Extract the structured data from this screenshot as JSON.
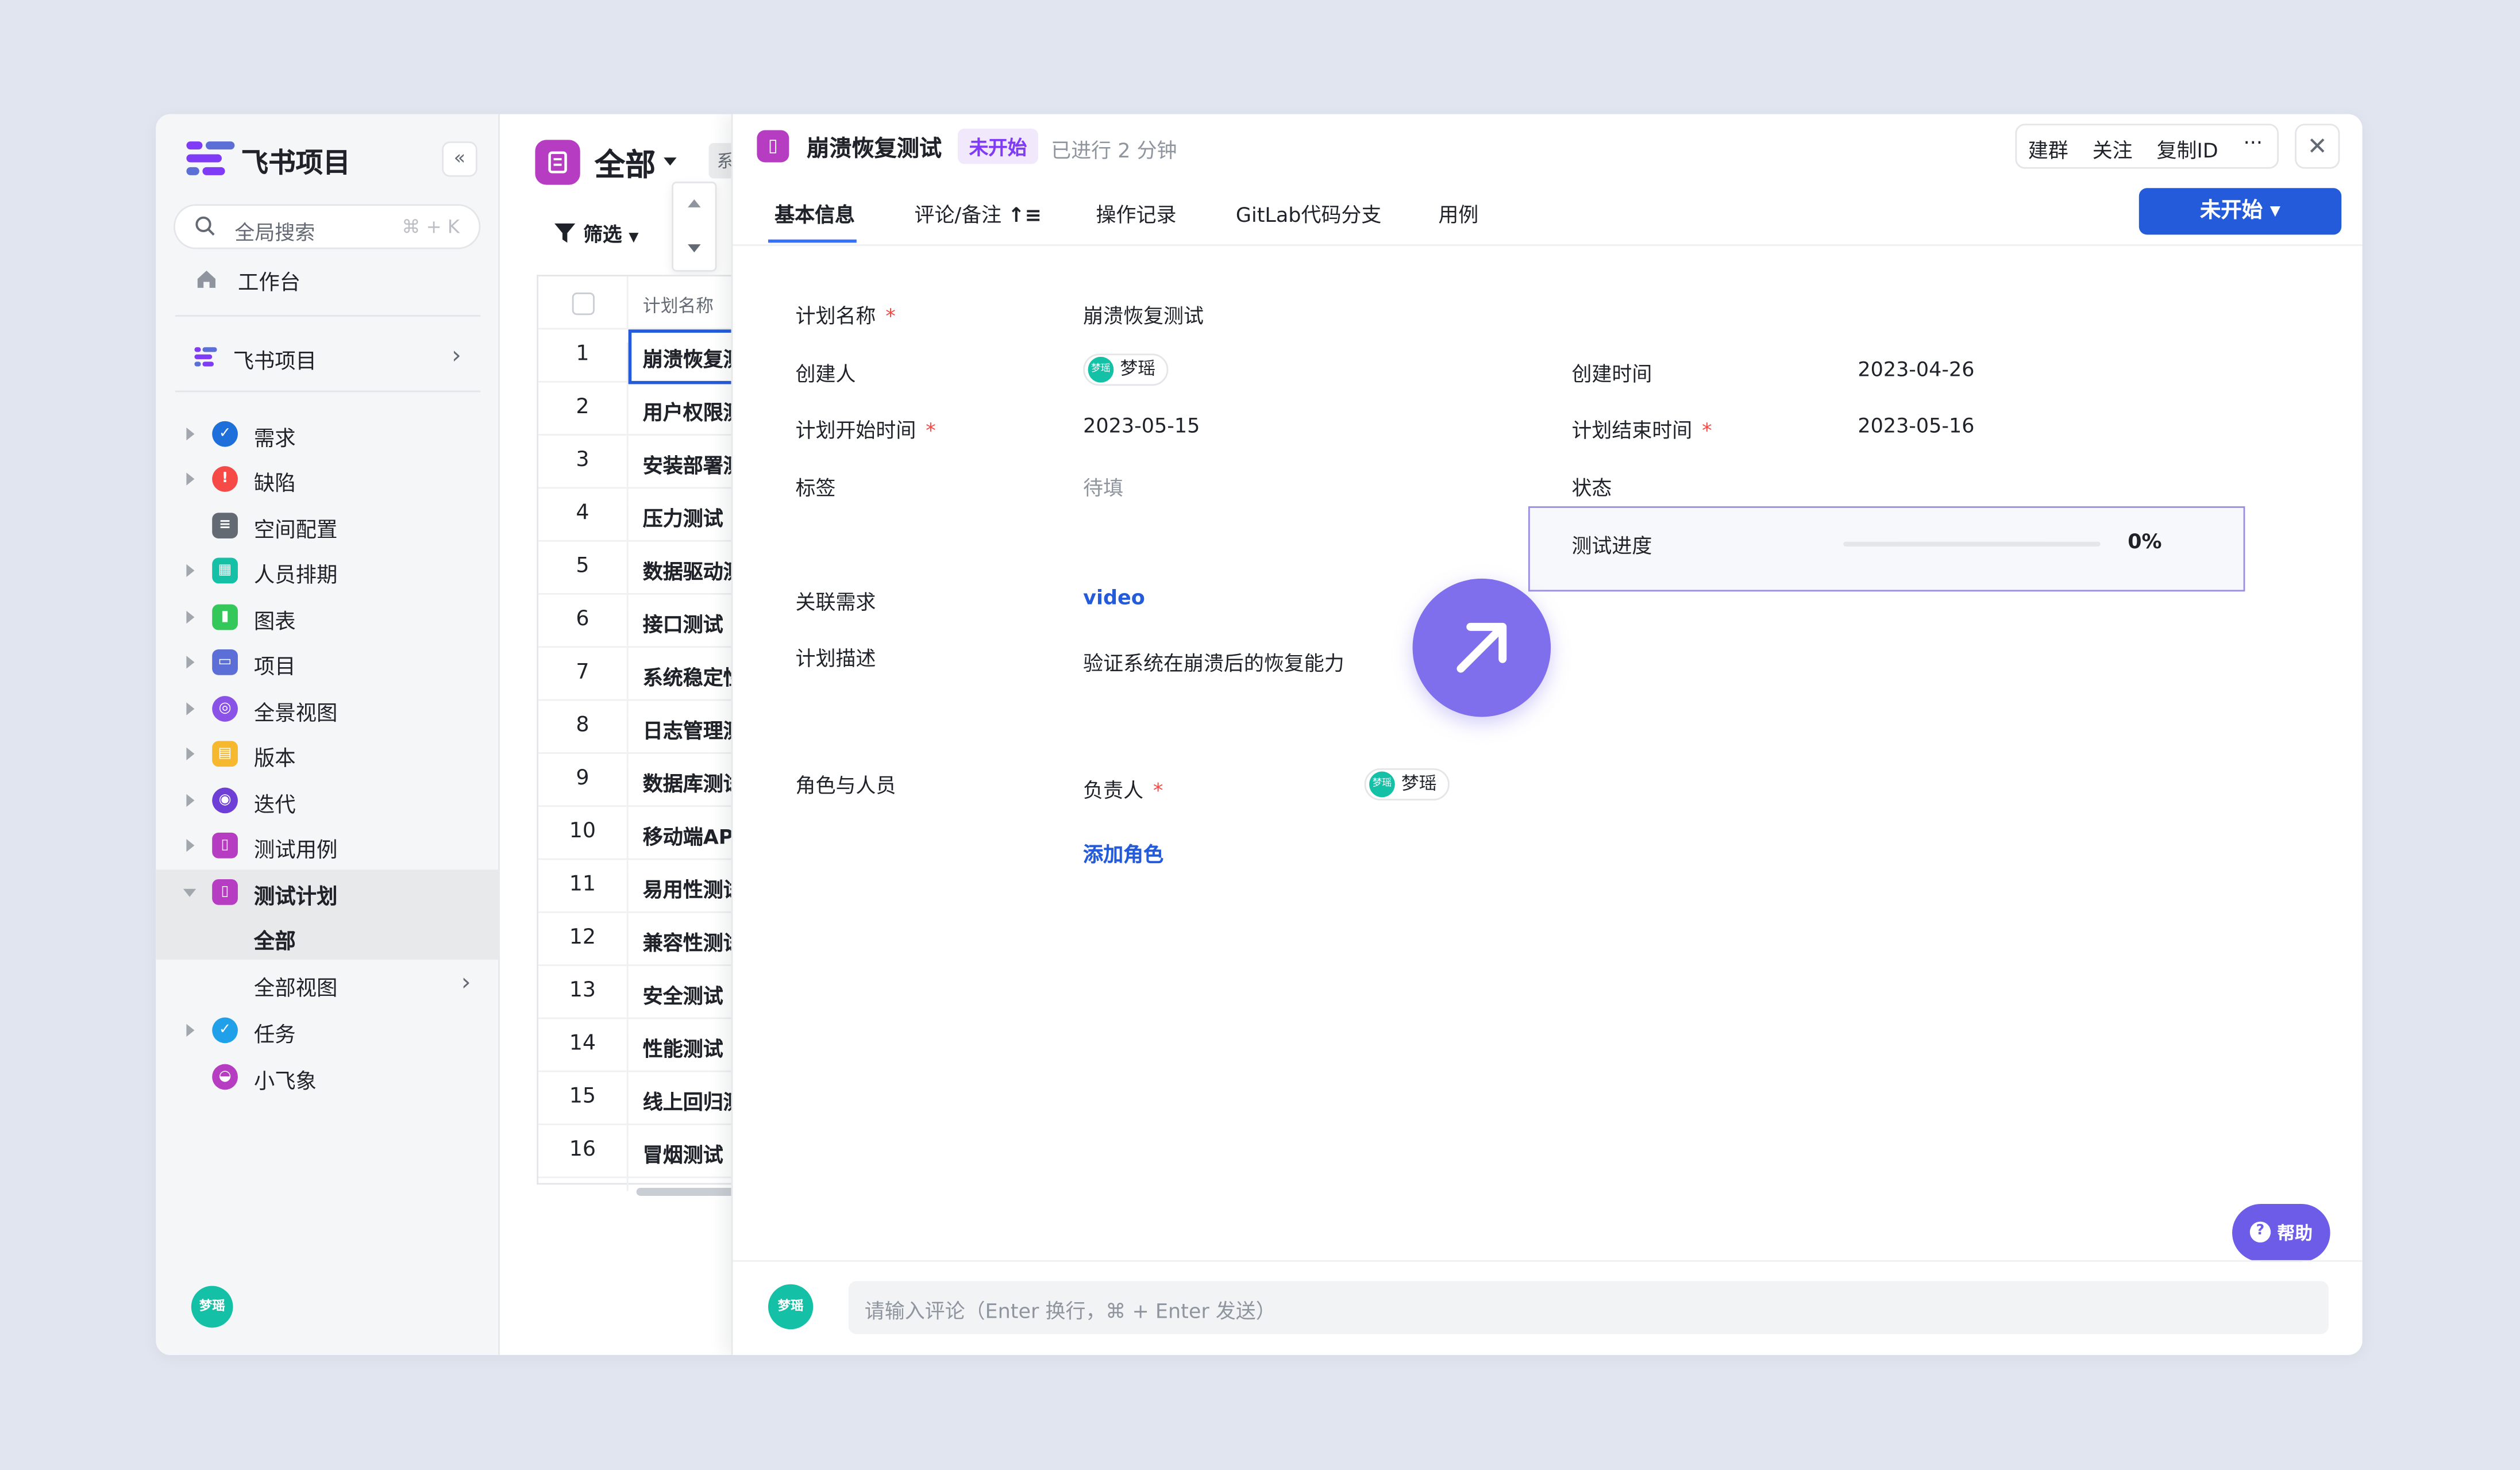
{
  "colors": {
    "brand_purple": "#b63cc2",
    "primary_blue": "#245bdb",
    "accent_purple": "#7f6fec",
    "badge_bg": "#f1e8fb",
    "badge_text": "#7f3bf5",
    "required_red": "#f54a45",
    "avatar_green": "#14c0a6"
  },
  "sidebar": {
    "brand": "飞书项目",
    "search": {
      "placeholder": "全局搜索",
      "shortcut": "⌘ + K"
    },
    "workbench": "工作台",
    "space": "飞书项目",
    "items": [
      {
        "label": "需求",
        "icon": "check-circle-icon",
        "color": "#1f6fdb"
      },
      {
        "label": "缺陷",
        "icon": "bug-icon",
        "color": "#f54a45"
      },
      {
        "label": "空间配置",
        "icon": "settings-list-icon",
        "color": "#646a73"
      },
      {
        "label": "人员排期",
        "icon": "calendar-icon",
        "color": "#14c0a6"
      },
      {
        "label": "图表",
        "icon": "chart-icon",
        "color": "#34c759"
      },
      {
        "label": "项目",
        "icon": "folder-icon",
        "color": "#5b6fd6"
      },
      {
        "label": "全景视图",
        "icon": "panorama-icon",
        "color": "#8b52e8"
      },
      {
        "label": "版本",
        "icon": "version-icon",
        "color": "#f5b82e"
      },
      {
        "label": "迭代",
        "icon": "iteration-icon",
        "color": "#6d3fd6"
      },
      {
        "label": "测试用例",
        "icon": "testcase-icon",
        "color": "#b63cc2"
      },
      {
        "label": "测试计划",
        "icon": "testplan-icon",
        "color": "#b63cc2"
      },
      {
        "label": "任务",
        "icon": "task-icon",
        "color": "#1fa0e8"
      },
      {
        "label": "小飞象",
        "icon": "elephant-icon",
        "color": "#b63cc2"
      }
    ],
    "sub_items": [
      {
        "label": "全部"
      },
      {
        "label": "全部视图"
      }
    ],
    "user_avatar": "梦瑶"
  },
  "list": {
    "title": "全部",
    "chip": "系",
    "filter_label": "筛选",
    "column_header": "计划名称",
    "rows": [
      {
        "num": "1",
        "name": "崩溃恢复测"
      },
      {
        "num": "2",
        "name": "用户权限测"
      },
      {
        "num": "3",
        "name": "安装部署测"
      },
      {
        "num": "4",
        "name": "压力测试"
      },
      {
        "num": "5",
        "name": "数据驱动测"
      },
      {
        "num": "6",
        "name": "接口测试"
      },
      {
        "num": "7",
        "name": "系统稳定性"
      },
      {
        "num": "8",
        "name": "日志管理测"
      },
      {
        "num": "9",
        "name": "数据库测试"
      },
      {
        "num": "10",
        "name": "移动端APP"
      },
      {
        "num": "11",
        "name": "易用性测试"
      },
      {
        "num": "12",
        "name": "兼容性测试"
      },
      {
        "num": "13",
        "name": "安全测试"
      },
      {
        "num": "14",
        "name": "性能测试"
      },
      {
        "num": "15",
        "name": "线上回归测"
      },
      {
        "num": "16",
        "name": "冒烟测试"
      }
    ]
  },
  "detail": {
    "title": "崩溃恢复测试",
    "badge": "未开始",
    "elapsed": "已进行 2 分钟",
    "actions": {
      "group": "建群",
      "follow": "关注",
      "copy_id": "复制ID",
      "more": "···",
      "close": "✕"
    },
    "tabs": [
      "基本信息",
      "评论/备注",
      "操作记录",
      "GitLab代码分支",
      "用例"
    ],
    "status_button": "未开始 ▾",
    "fields": {
      "plan_name": {
        "label": "计划名称",
        "value": "崩溃恢复测试"
      },
      "creator": {
        "label": "创建人",
        "value": "梦瑶"
      },
      "created_time": {
        "label": "创建时间",
        "value": "2023-04-26"
      },
      "start_time": {
        "label": "计划开始时间",
        "value": "2023-05-15"
      },
      "end_time": {
        "label": "计划结束时间",
        "value": "2023-05-16"
      },
      "tags": {
        "label": "标签",
        "value": "待填"
      },
      "status": {
        "label": "状态"
      },
      "progress": {
        "label": "测试进度",
        "value": "0%",
        "fraction": 0
      },
      "related_req": {
        "label": "关联需求",
        "value": "video"
      },
      "description": {
        "label": "计划描述",
        "value": "验证系统在崩溃后的恢复能力"
      },
      "roles": {
        "label": "角色与人员",
        "owner_label": "负责人",
        "owner": "梦瑶",
        "add_role": "添加角色"
      }
    },
    "required_mark": "*",
    "help": "帮助",
    "comment": {
      "avatar": "梦瑶",
      "placeholder": "请输入评论（Enter 换行，⌘ + Enter 发送）"
    }
  }
}
